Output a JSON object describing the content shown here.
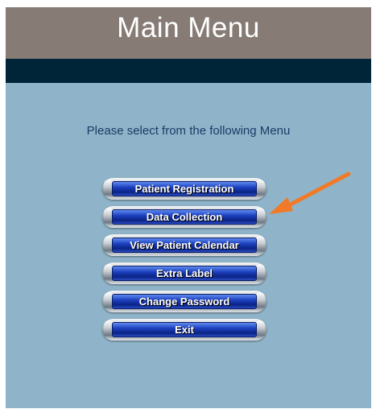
{
  "header": {
    "title": "Main Menu"
  },
  "prompt": "Please select from the following Menu",
  "menu": {
    "items": [
      {
        "label": "Patient Registration"
      },
      {
        "label": "Data Collection"
      },
      {
        "label": "View Patient Calendar"
      },
      {
        "label": "Extra Label"
      },
      {
        "label": "Change Password"
      },
      {
        "label": "Exit"
      }
    ]
  },
  "colors": {
    "title_bar": "#877c75",
    "sub_bar": "#012538",
    "background": "#8fb4c9",
    "button_blue": "#1c3fbd",
    "arrow": "#f07a28"
  },
  "annotation": {
    "icon": "arrow-icon",
    "points_to": "Data Collection"
  }
}
